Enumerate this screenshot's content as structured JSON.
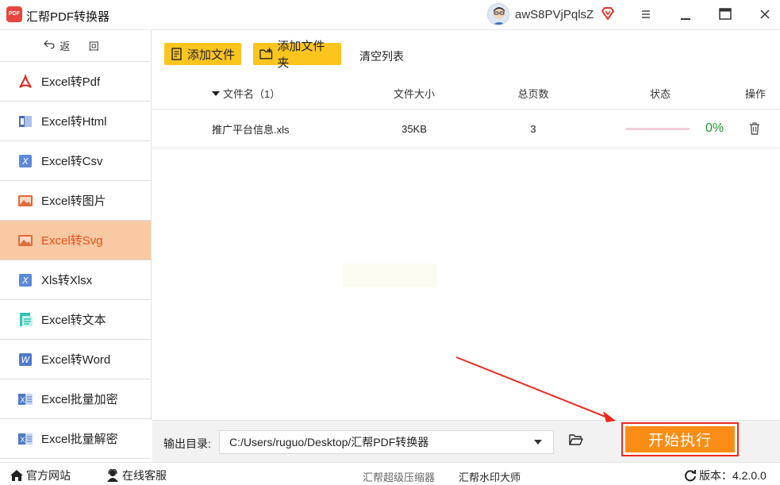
{
  "app": {
    "title": "汇帮PDF转换器",
    "logo_text": "PDF",
    "user_name": "awS8PVjPqlsZ"
  },
  "sidebar": {
    "back_label": "返 回",
    "items": [
      {
        "label": "Excel转Pdf",
        "icon": "pdf-icon",
        "active": false
      },
      {
        "label": "Excel转Html",
        "icon": "html-icon",
        "active": false
      },
      {
        "label": "Excel转Csv",
        "icon": "csv-icon",
        "active": false
      },
      {
        "label": "Excel转图片",
        "icon": "image-icon",
        "active": false
      },
      {
        "label": "Excel转Svg",
        "icon": "svg-image-icon",
        "active": true
      },
      {
        "label": "Xls转Xlsx",
        "icon": "xlsx-icon",
        "active": false
      },
      {
        "label": "Excel转文本",
        "icon": "text-icon",
        "active": false
      },
      {
        "label": "Excel转Word",
        "icon": "word-icon",
        "active": false
      },
      {
        "label": "Excel批量加密",
        "icon": "excel-lock-icon",
        "active": false
      },
      {
        "label": "Excel批量解密",
        "icon": "excel-unlock-icon",
        "active": false
      }
    ]
  },
  "toolbar": {
    "add_file": "添加文件",
    "add_folder": "添加文件夹",
    "clear_list": "清空列表"
  },
  "table": {
    "headers": {
      "name": "文件名（1）",
      "size": "文件大小",
      "pages": "总页数",
      "status": "状态",
      "op": "操作"
    },
    "rows": [
      {
        "name": "推广平台信息.xls",
        "size": "35KB",
        "pages": "3",
        "progress": 0,
        "percent": "0%"
      }
    ]
  },
  "output": {
    "label": "输出目录:",
    "path": "C:/Users/ruguo/Desktop/汇帮PDF转换器",
    "start_label": "开始执行"
  },
  "statusbar": {
    "site": "官方网站",
    "service": "在线客服",
    "compress": "汇帮超级压缩器",
    "watermark": "汇帮水印大师",
    "version": "版本：4.2.0.0"
  },
  "colors": {
    "accent_orange": "#fb8d16",
    "active_item_bg": "#f9c9a3",
    "active_item_text": "#e94e16",
    "toolbar_yellow": "#fcc51e",
    "percent_green": "#1a9a2a",
    "annotation_red": "#ee2a1f"
  }
}
